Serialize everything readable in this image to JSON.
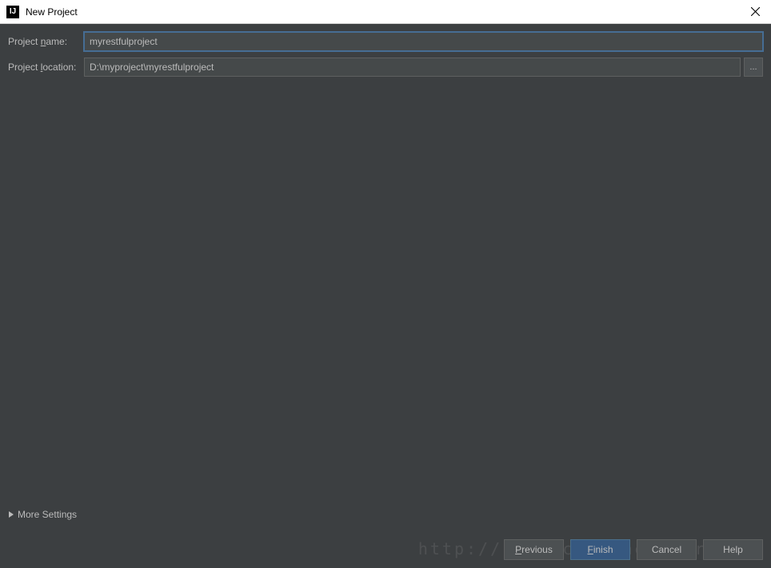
{
  "titlebar": {
    "icon_label": "IJ",
    "title": "New Project"
  },
  "form": {
    "project_name_label": "Project name:",
    "project_name_value": "myrestfulproject",
    "project_location_label": "Project location:",
    "project_location_value": "D:\\myproject\\myrestfulproject",
    "browse_label": "..."
  },
  "more_settings": {
    "label": "More Settings"
  },
  "buttons": {
    "previous": "Previous",
    "finish": "Finish",
    "cancel": "Cancel",
    "help": "Help"
  },
  "watermark": "http://blog.csdn.net/forMelo"
}
